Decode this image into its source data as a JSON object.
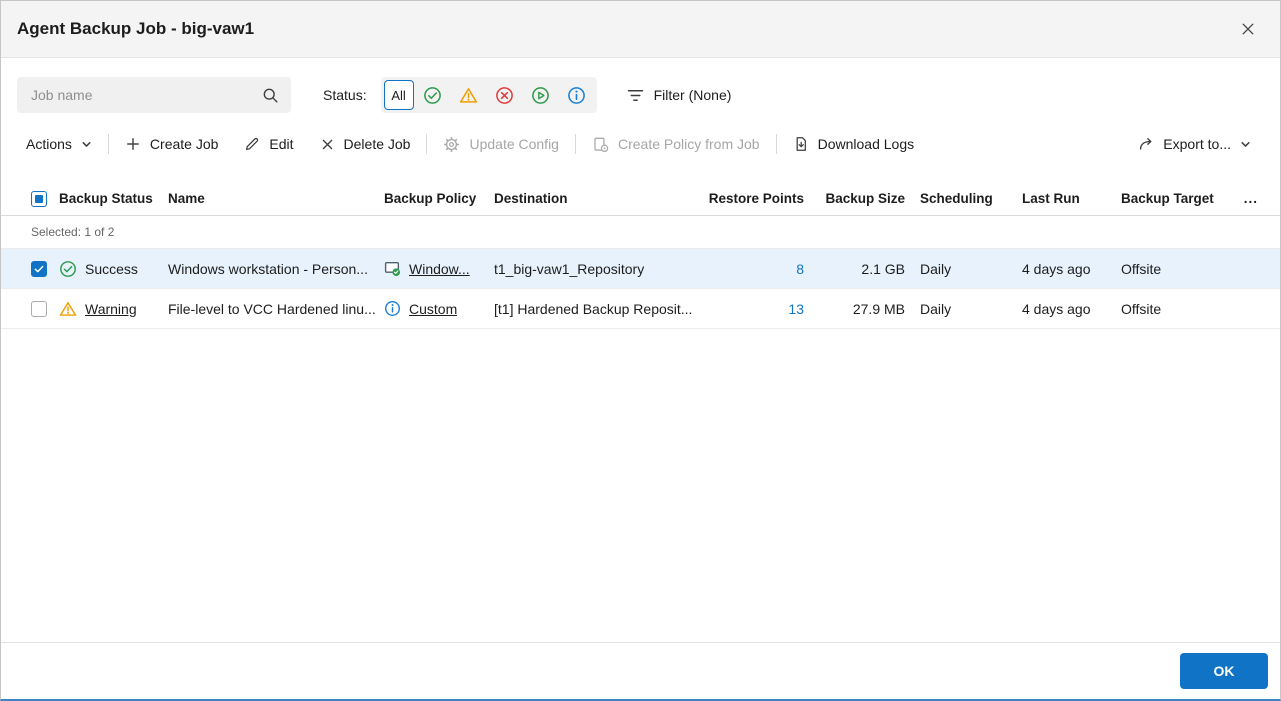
{
  "window": {
    "title": "Agent Backup Job - big-vaw1"
  },
  "filters": {
    "search_placeholder": "Job name",
    "search_icon": "search-icon",
    "status_label": "Status:",
    "status_all_label": "All",
    "status_icons": [
      "success-circle-icon",
      "warning-triangle-icon",
      "error-circle-icon",
      "running-circle-icon",
      "info-circle-icon"
    ],
    "filter_icon": "filter-lines-icon",
    "filter_label": "Filter (None)"
  },
  "toolbar": {
    "actions_label": "Actions",
    "create_job_label": "Create Job",
    "edit_label": "Edit",
    "delete_job_label": "Delete Job",
    "update_config_label": "Update Config",
    "create_policy_label": "Create Policy from Job",
    "download_logs_label": "Download Logs",
    "export_label": "Export to..."
  },
  "table": {
    "selected_summary": "Selected: 1 of 2",
    "headers": {
      "backup_status": "Backup Status",
      "name": "Name",
      "backup_policy": "Backup Policy",
      "destination": "Destination",
      "restore_points": "Restore Points",
      "backup_size": "Backup Size",
      "scheduling": "Scheduling",
      "last_run": "Last Run",
      "backup_target": "Backup Target",
      "more": "..."
    },
    "rows": [
      {
        "checked": true,
        "status": "Success",
        "status_icon": "success-circle-icon",
        "name": "Windows workstation - Person...",
        "policy": "Window...",
        "policy_icon": "windows-policy-icon",
        "destination": "t1_big-vaw1_Repository",
        "restore_points": "8",
        "backup_size": "2.1 GB",
        "scheduling": "Daily",
        "last_run": "4 days ago",
        "backup_target": "Offsite"
      },
      {
        "checked": false,
        "status": "Warning",
        "status_icon": "warning-triangle-icon",
        "name": "File-level to VCC Hardened linu...",
        "policy": "Custom",
        "policy_icon": "custom-policy-icon",
        "destination": "[t1] Hardened Backup Reposit...",
        "restore_points": "13",
        "backup_size": "27.9 MB",
        "scheduling": "Daily",
        "last_run": "4 days ago",
        "backup_target": "Offsite"
      }
    ]
  },
  "footer": {
    "ok_label": "OK"
  },
  "colors": {
    "accent": "#1173c6",
    "success": "#2e9b4a",
    "warning": "#ef9f00",
    "error": "#e03c3c",
    "info": "#1a7fd4",
    "selected_row_bg": "#e7f2fc"
  }
}
